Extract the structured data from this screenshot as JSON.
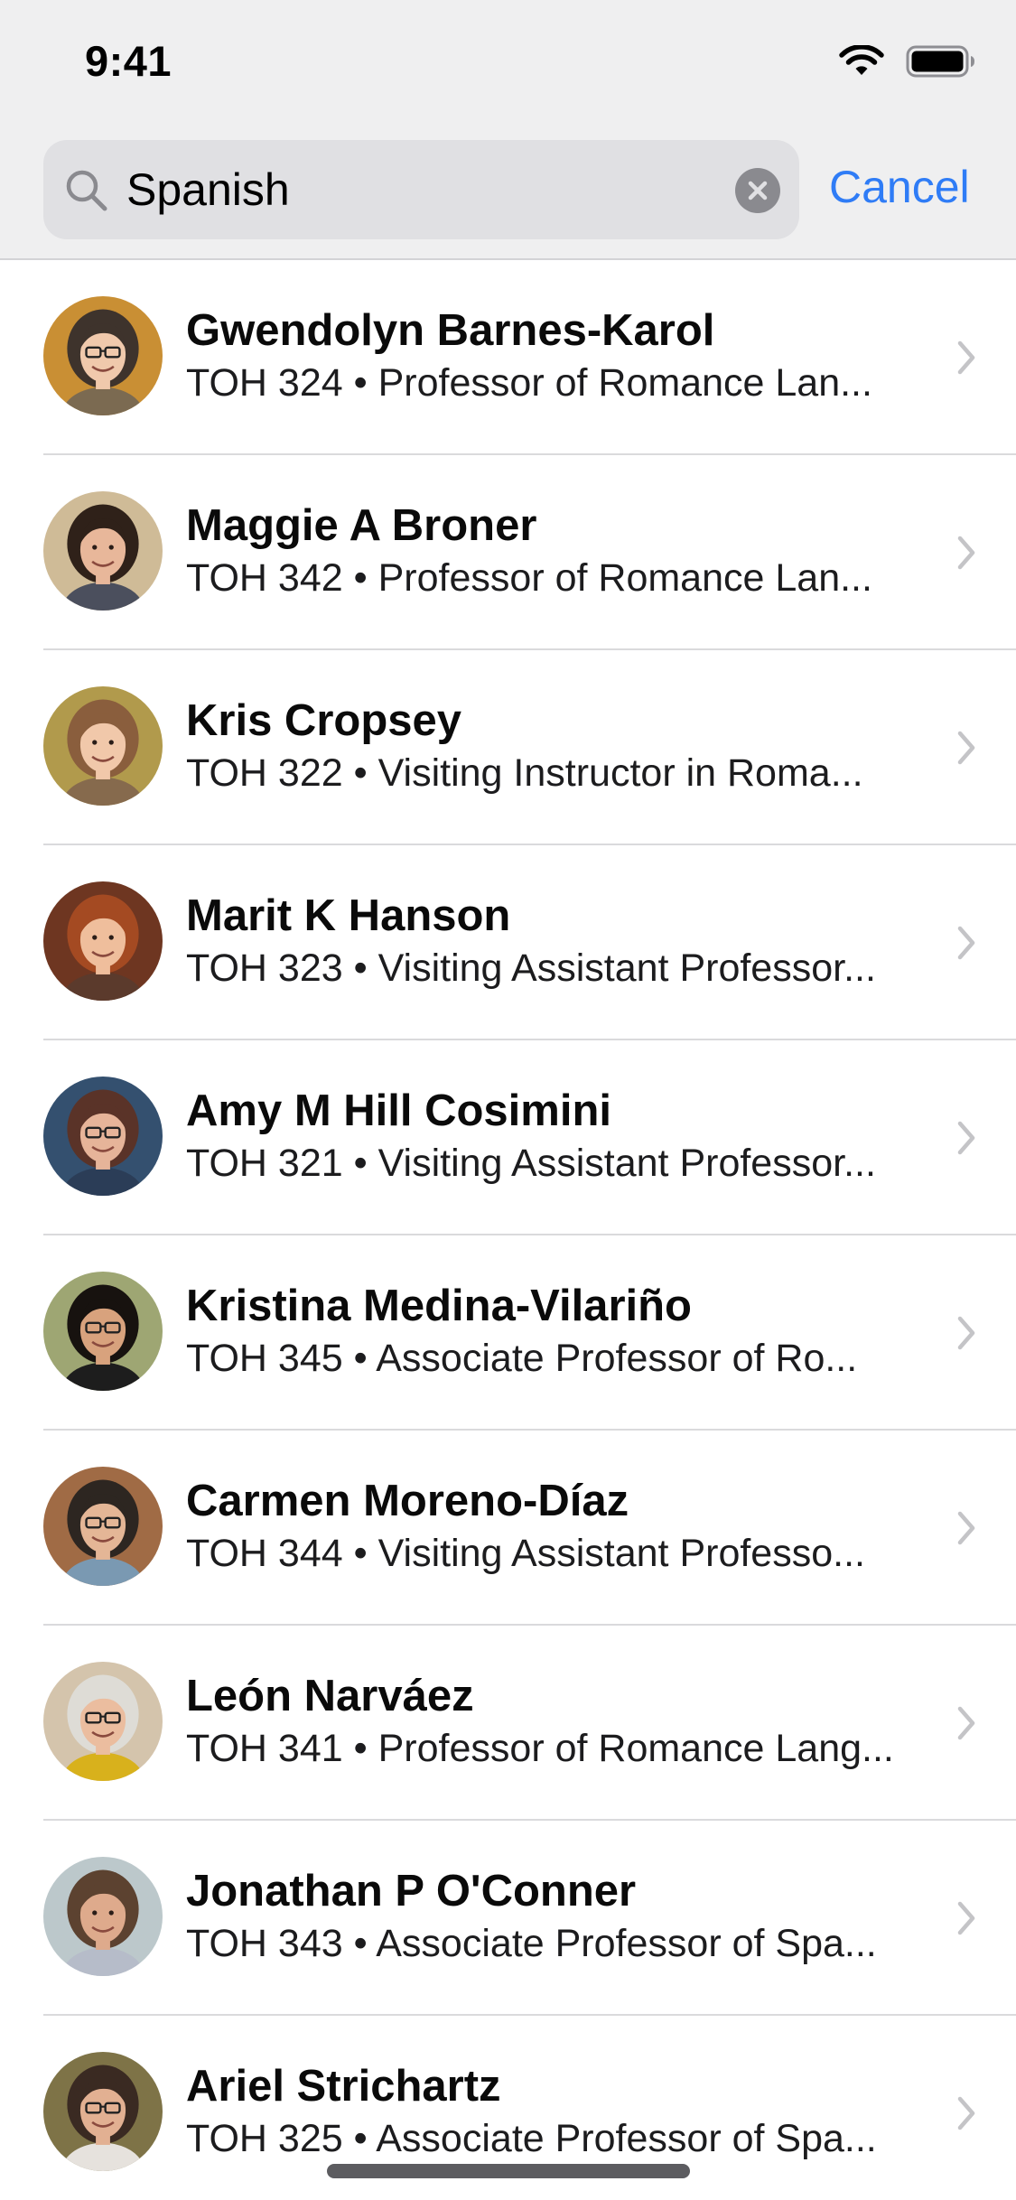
{
  "status_bar": {
    "time": "9:41"
  },
  "search": {
    "query": "Spanish",
    "cancel_label": "Cancel"
  },
  "people": [
    {
      "name": "Gwendolyn Barnes-Karol",
      "detail": "TOH 324 • Professor of Romance Lan...",
      "avatar": {
        "bg": "#c98f34",
        "skin": "#f0c9ac",
        "hair": "#3e332c",
        "shirt": "#7b6a51",
        "glasses": true
      }
    },
    {
      "name": "Maggie A Broner",
      "detail": "TOH 342 • Professor of Romance Lan...",
      "avatar": {
        "bg": "#cfbb97",
        "skin": "#e8b79a",
        "hair": "#2f2119",
        "shirt": "#4b4f5d",
        "glasses": false
      }
    },
    {
      "name": "Kris Cropsey",
      "detail": "TOH 322 • Visiting Instructor in Roma...",
      "avatar": {
        "bg": "#b19a4c",
        "skin": "#f1c8aa",
        "hair": "#8a5e3d",
        "shirt": "#866a4d",
        "glasses": false
      }
    },
    {
      "name": "Marit K Hanson",
      "detail": "TOH 323 • Visiting Assistant Professor...",
      "avatar": {
        "bg": "#6e3621",
        "skin": "#efbe9c",
        "hair": "#a44a22",
        "shirt": "#5b3a2c",
        "glasses": false
      }
    },
    {
      "name": "Amy M Hill Cosimini",
      "detail": "TOH 321 • Visiting Assistant Professor...",
      "avatar": {
        "bg": "#34506f",
        "skin": "#e6b499",
        "hair": "#5a3328",
        "shirt": "#2b3d57",
        "glasses": true
      }
    },
    {
      "name": "Kristina Medina-Vilariño",
      "detail": "TOH 345 • Associate Professor of Ro...",
      "avatar": {
        "bg": "#9ea673",
        "skin": "#d8a27d",
        "hair": "#17120f",
        "shirt": "#1d1d1d",
        "glasses": true
      }
    },
    {
      "name": "Carmen Moreno-Díaz",
      "detail": "TOH 344 • Visiting Assistant Professo...",
      "avatar": {
        "bg": "#a06b45",
        "skin": "#e4b696",
        "hair": "#2d2621",
        "shirt": "#7a99b2",
        "glasses": true
      }
    },
    {
      "name": "León Narváez",
      "detail": "TOH 341 • Professor of Romance Lang...",
      "avatar": {
        "bg": "#d4c4ac",
        "skin": "#ebbd9f",
        "hair": "#dedcd6",
        "shirt": "#d8b11c",
        "glasses": true
      }
    },
    {
      "name": "Jonathan P O'Conner",
      "detail": "TOH 343 • Associate Professor of Spa...",
      "avatar": {
        "bg": "#bcc8cb",
        "skin": "#deaa8c",
        "hair": "#5c4230",
        "shirt": "#b6bcc9",
        "glasses": false
      }
    },
    {
      "name": "Ariel Strichartz",
      "detail": "TOH 325 • Associate Professor of Spa...",
      "avatar": {
        "bg": "#7e7347",
        "skin": "#e2b092",
        "hair": "#3a2a22",
        "shirt": "#e6e2dd",
        "glasses": true
      }
    }
  ]
}
